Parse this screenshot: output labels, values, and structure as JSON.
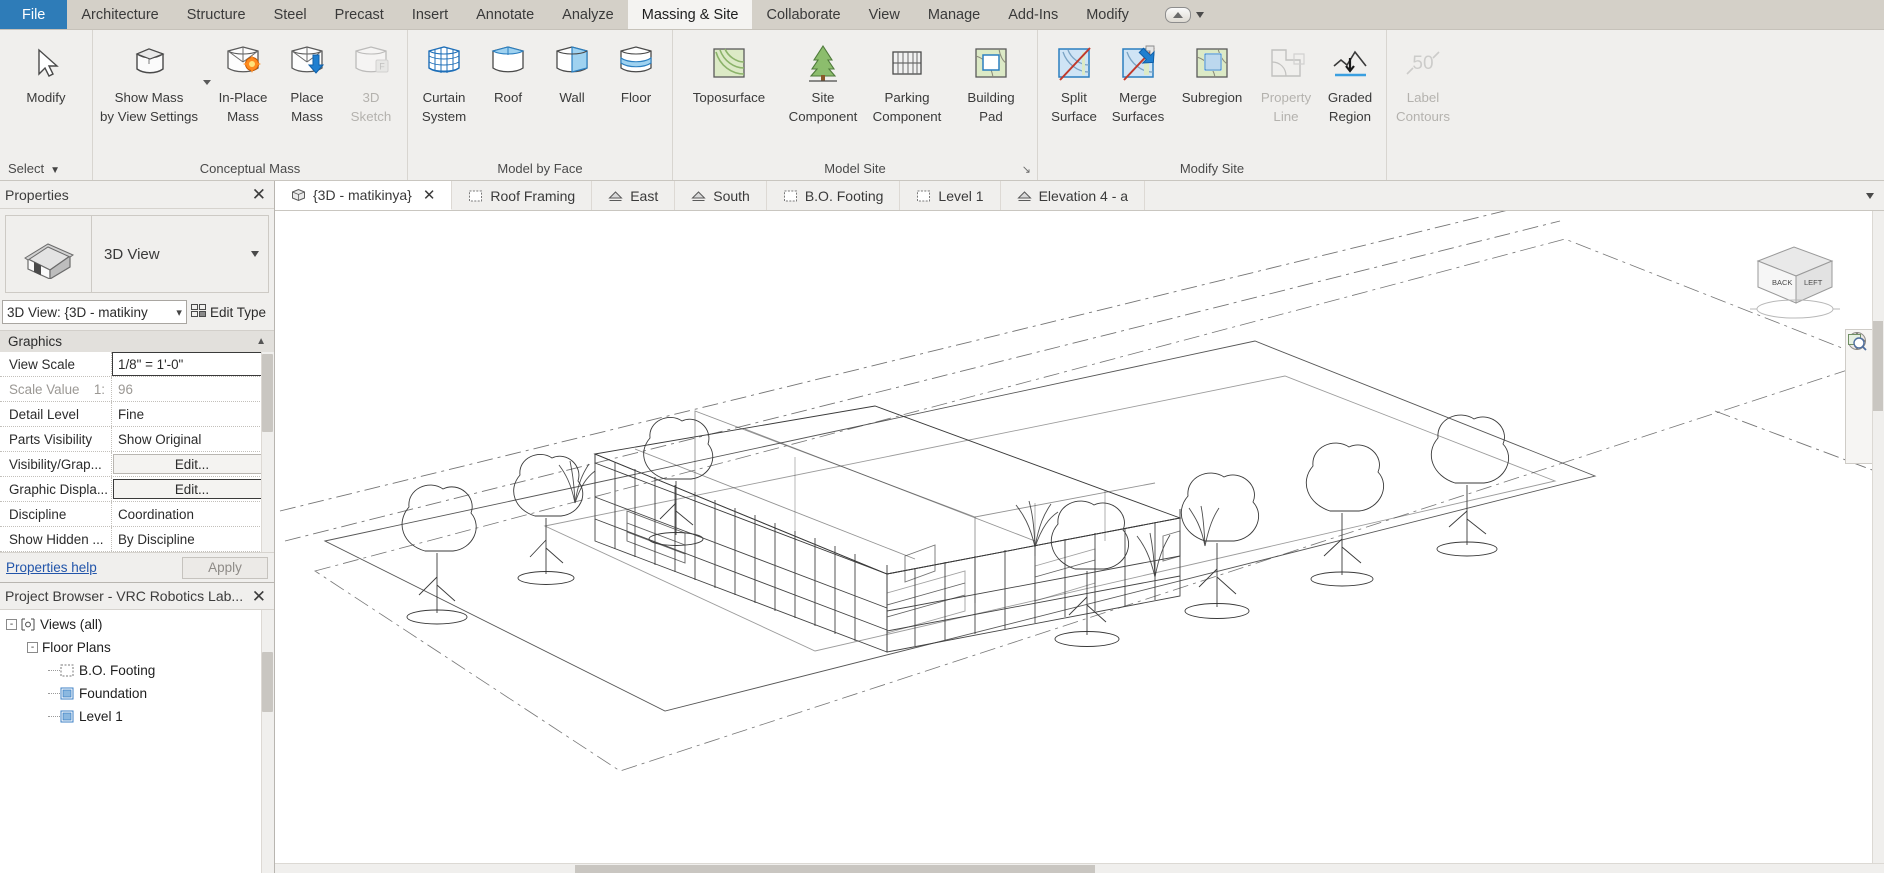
{
  "menubar": {
    "file_label": "File",
    "items": [
      {
        "label": "Architecture",
        "active": false
      },
      {
        "label": "Structure",
        "active": false
      },
      {
        "label": "Steel",
        "active": false
      },
      {
        "label": "Precast",
        "active": false
      },
      {
        "label": "Insert",
        "active": false
      },
      {
        "label": "Annotate",
        "active": false
      },
      {
        "label": "Analyze",
        "active": false
      },
      {
        "label": "Massing & Site",
        "active": true
      },
      {
        "label": "Collaborate",
        "active": false
      },
      {
        "label": "View",
        "active": false
      },
      {
        "label": "Manage",
        "active": false
      },
      {
        "label": "Add-Ins",
        "active": false
      },
      {
        "label": "Modify",
        "active": false
      }
    ]
  },
  "ribbon": {
    "groups": [
      {
        "title": "Select",
        "title_align": "left",
        "title_caret": true,
        "buttons": [
          {
            "name": "modify",
            "label": "Modify",
            "icon": "cursor-arrow-icon",
            "disabled": false,
            "width": "wide"
          }
        ]
      },
      {
        "title": "Conceptual Mass",
        "buttons": [
          {
            "name": "show-mass-by-view-settings",
            "label": "Show Mass\nby View Settings",
            "icon": "mass-box-icon",
            "disabled": false,
            "width": "xwide",
            "dropdown": true
          },
          {
            "name": "in-place-mass",
            "label": "In-Place\nMass",
            "icon": "in-place-mass-icon",
            "disabled": false,
            "width": "normal"
          },
          {
            "name": "place-mass",
            "label": "Place\nMass",
            "icon": "place-mass-icon",
            "disabled": false,
            "width": "normal"
          },
          {
            "name": "3d-sketch",
            "label": "3D\nSketch",
            "icon": "3d-sketch-icon",
            "disabled": true,
            "width": "normal"
          }
        ]
      },
      {
        "title": "Model by Face",
        "buttons": [
          {
            "name": "curtain-system",
            "label": "Curtain\nSystem",
            "icon": "curtain-system-icon",
            "disabled": false,
            "width": "normal"
          },
          {
            "name": "roof",
            "label": "Roof",
            "icon": "roof-by-face-icon",
            "disabled": false,
            "width": "normal"
          },
          {
            "name": "wall",
            "label": "Wall",
            "icon": "wall-by-face-icon",
            "disabled": false,
            "width": "normal"
          },
          {
            "name": "floor",
            "label": "Floor",
            "icon": "floor-by-face-icon",
            "disabled": false,
            "width": "normal"
          }
        ]
      },
      {
        "title": "Model Site",
        "dialog_launcher": true,
        "buttons": [
          {
            "name": "toposurface",
            "label": "Toposurface",
            "icon": "toposurface-icon",
            "disabled": false,
            "width": "xwide"
          },
          {
            "name": "site-component",
            "label": "Site\nComponent",
            "icon": "tree-icon",
            "disabled": false,
            "width": "wide"
          },
          {
            "name": "parking-component",
            "label": "Parking\nComponent",
            "icon": "parking-icon",
            "disabled": false,
            "width": "wide"
          },
          {
            "name": "building-pad",
            "label": "Building\nPad",
            "icon": "building-pad-icon",
            "disabled": false,
            "width": "wide"
          }
        ]
      },
      {
        "title": "Modify Site",
        "buttons": [
          {
            "name": "split-surface",
            "label": "Split\nSurface",
            "icon": "split-surface-icon",
            "disabled": false,
            "width": "normal"
          },
          {
            "name": "merge-surfaces",
            "label": "Merge\nSurfaces",
            "icon": "merge-surfaces-icon",
            "disabled": false,
            "width": "normal"
          },
          {
            "name": "subregion",
            "label": "Subregion",
            "icon": "subregion-icon",
            "disabled": false,
            "width": "wide"
          },
          {
            "name": "property-line",
            "label": "Property\nLine",
            "icon": "property-line-icon",
            "disabled": true,
            "width": "normal"
          },
          {
            "name": "graded-region",
            "label": "Graded\nRegion",
            "icon": "graded-region-icon",
            "disabled": false,
            "width": "normal"
          }
        ]
      },
      {
        "title": "",
        "buttons": [
          {
            "name": "label-contours",
            "label": "Label\nContours",
            "icon": "label-contours-icon",
            "disabled": true,
            "width": "normal"
          }
        ]
      }
    ]
  },
  "properties": {
    "panel_title": "Properties",
    "close_icon": "close-icon",
    "type_label": "3D View",
    "type_icon": "3d-view-house-icon",
    "selector_value": "3D View: {3D - matikiny",
    "edit_type_label": "Edit Type",
    "edit_type_icon": "edit-type-icon",
    "section_header": "Graphics",
    "rows": [
      {
        "key": "View Scale",
        "value": "1/8\" = 1'-0\"",
        "style": "boxed",
        "dim_key": false,
        "dim_value": false
      },
      {
        "key": "Scale Value",
        "sub": "1:",
        "value": "96",
        "style": "plain",
        "dim_key": true,
        "dim_value": true
      },
      {
        "key": "Detail Level",
        "value": "Fine",
        "style": "plain",
        "dim_key": false,
        "dim_value": false
      },
      {
        "key": "Parts Visibility",
        "value": "Show Original",
        "style": "plain",
        "dim_key": false,
        "dim_value": false
      },
      {
        "key": "Visibility/Grap...",
        "value": "Edit...",
        "style": "button",
        "dim_key": false,
        "dim_value": false
      },
      {
        "key": "Graphic Displa...",
        "value": "Edit...",
        "style": "button-strong",
        "dim_key": false,
        "dim_value": false
      },
      {
        "key": "Discipline",
        "value": "Coordination",
        "style": "plain",
        "dim_key": false,
        "dim_value": false
      },
      {
        "key": "Show Hidden ...",
        "value": "By Discipline",
        "style": "plain",
        "dim_key": false,
        "dim_value": false
      }
    ],
    "help_label": "Properties help",
    "apply_label": "Apply"
  },
  "project_browser": {
    "panel_title": "Project Browser - VRC Robotics Lab...",
    "close_icon": "close-icon",
    "nodes": [
      {
        "label": "Views (all)",
        "depth": 0,
        "expander": "-",
        "icon": "views-icon"
      },
      {
        "label": "Floor Plans",
        "depth": 1,
        "expander": "-",
        "icon": "none"
      },
      {
        "label": "B.O. Footing",
        "depth": 2,
        "expander": "",
        "icon": "floorplan-dashed-icon"
      },
      {
        "label": "Foundation",
        "depth": 2,
        "expander": "",
        "icon": "floorplan-blue-icon"
      },
      {
        "label": "Level 1",
        "depth": 2,
        "expander": "",
        "icon": "floorplan-blue-icon"
      }
    ]
  },
  "view_tabs": {
    "tabs": [
      {
        "label": "{3D - matikinya}",
        "icon": "3d-view-icon",
        "active": true,
        "closable": true
      },
      {
        "label": "Roof Framing",
        "icon": "plan-view-icon",
        "active": false,
        "closable": false
      },
      {
        "label": "East",
        "icon": "elevation-icon",
        "active": false,
        "closable": false
      },
      {
        "label": "South",
        "icon": "elevation-icon",
        "active": false,
        "closable": false
      },
      {
        "label": "B.O. Footing",
        "icon": "plan-view-icon",
        "active": false,
        "closable": false
      },
      {
        "label": "Level 1",
        "icon": "plan-view-icon",
        "active": false,
        "closable": false
      },
      {
        "label": "Elevation 4 - a",
        "icon": "elevation-icon",
        "active": false,
        "closable": false
      }
    ],
    "overflow_icon": "chevron-down-icon"
  },
  "canvas": {
    "viewcube": {
      "face_top_left": "BACK",
      "face_top_right": "LEFT"
    },
    "navigation_bar": {
      "icons": [
        "steering-wheel-icon",
        "pan-icon",
        "zoom-region-icon",
        "chevron-down-icon"
      ]
    }
  },
  "colors": {
    "accent_blue": "#2e7cb8",
    "menubar_bg": "#d4d0c8",
    "ribbon_bg": "#f0efed",
    "link_blue": "#2255aa",
    "canvas_bg": "#ffffff",
    "tree_icon_blue": "#3b7fc4",
    "site_green": "#7aa856"
  }
}
